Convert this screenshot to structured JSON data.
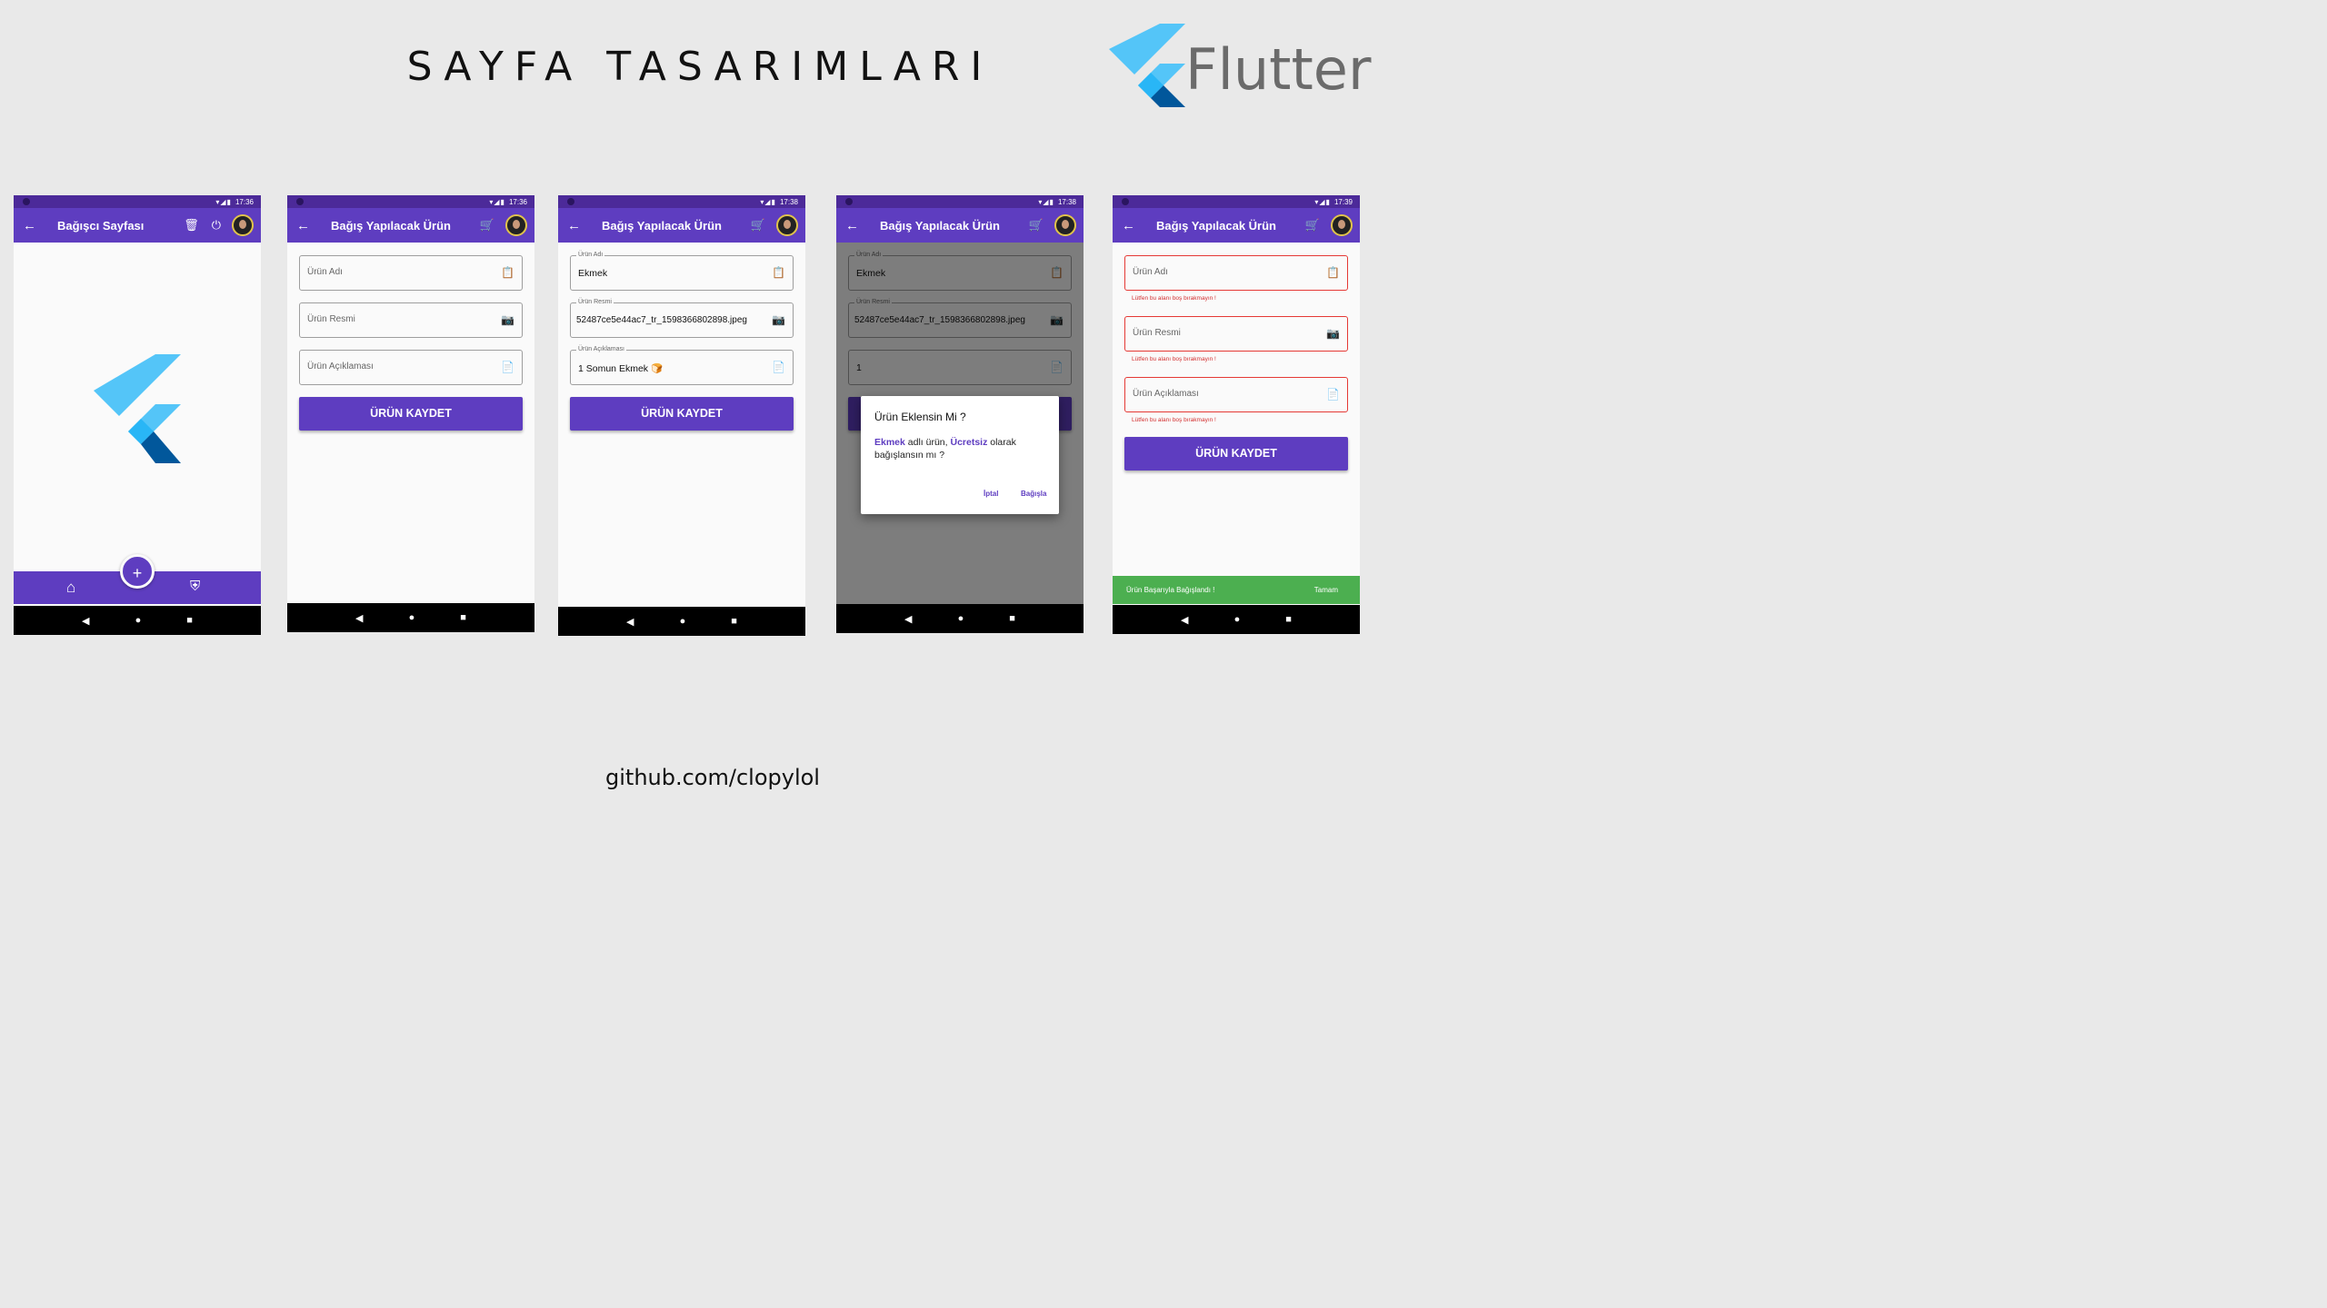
{
  "header": {
    "title": "SAYFA TASARIMLARI",
    "brand": "Flutter"
  },
  "footer": {
    "link": "github.com/clopylol"
  },
  "colors": {
    "primary": "#5e3dc0",
    "status_bar": "#4c2a99",
    "error": "#e53935",
    "success": "#4caf50",
    "background": "#e9e9e9"
  },
  "screens": [
    {
      "status_time": "17:36",
      "appbar_title": "Bağışcı Sayfası",
      "actions": [
        "delete-icon",
        "power-icon",
        "avatar"
      ],
      "bottom_nav": {
        "fab": "+",
        "items": [
          "home-icon",
          "security-icon"
        ]
      }
    },
    {
      "status_time": "17:36",
      "appbar_title": "Bağış Yapılacak Ürün",
      "fields": [
        {
          "placeholder": "Ürün Adı",
          "icon": "clipboard-icon"
        },
        {
          "placeholder": "Ürün Resmi",
          "icon": "add-photo-icon"
        },
        {
          "placeholder": "Ürün Açıklaması",
          "icon": "description-icon"
        }
      ],
      "button": "ÜRÜN KAYDET"
    },
    {
      "status_time": "17:38",
      "appbar_title": "Bağış Yapılacak Ürün",
      "fields": [
        {
          "label": "Ürün Adı",
          "value": "Ekmek"
        },
        {
          "label": "Ürün Resmi",
          "value": "52487ce5e44ac7_tr_1598366802898.jpeg"
        },
        {
          "label": "Ürün Açıklaması",
          "value": "1 Somun Ekmek 🍞"
        }
      ],
      "button": "ÜRÜN KAYDET"
    },
    {
      "status_time": "17:38",
      "appbar_title": "Bağış Yapılacak Ürün",
      "fields": [
        {
          "label": "Ürün Adı",
          "value": "Ekmek"
        },
        {
          "label": "Ürün Resmi",
          "value": "52487ce5e44ac7_tr_1598366802898.jpeg"
        },
        {
          "value": "1"
        }
      ],
      "dialog": {
        "title": "Ürün Eklensin Mi ?",
        "product": "Ekmek",
        "text1": " adlı ürün, ",
        "free": "Ücretsiz",
        "text2": " olarak bağışlansın mı ?",
        "cancel": "İptal",
        "confirm": "Bağışla"
      }
    },
    {
      "status_time": "17:39",
      "appbar_title": "Bağış Yapılacak Ürün",
      "fields": [
        {
          "placeholder": "Ürün Adı",
          "error": "Lütfen bu alanı boş bırakmayın !"
        },
        {
          "placeholder": "Ürün Resmi",
          "error": "Lütfen bu alanı boş bırakmayın !"
        },
        {
          "placeholder": "Ürün Açıklaması",
          "error": "Lütfen bu alanı boş bırakmayın !"
        }
      ],
      "button": "ÜRÜN KAYDET",
      "snackbar": {
        "message": "Ürün Başarıyla Bağışlandı !",
        "action": "Tamam"
      }
    }
  ]
}
